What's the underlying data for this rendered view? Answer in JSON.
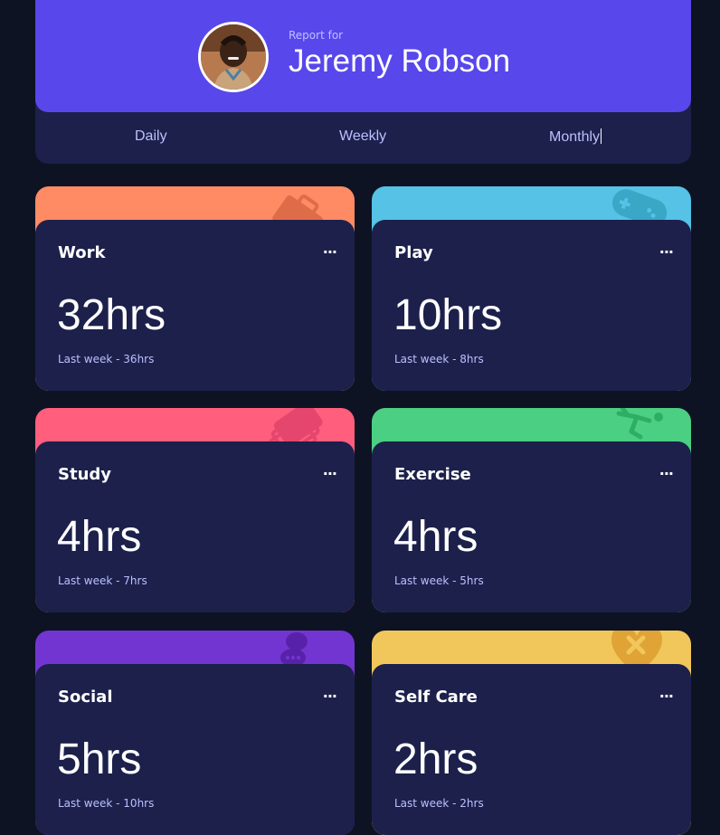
{
  "profile": {
    "report_for": "Report for",
    "name": "Jeremy Robson"
  },
  "tabs": [
    {
      "label": "Daily"
    },
    {
      "label": "Weekly"
    },
    {
      "label": "Monthly",
      "active": true
    }
  ],
  "cards": [
    {
      "title": "Work",
      "hours": "32hrs",
      "previous": "Last week - 36hrs",
      "menu": "...",
      "color": "#ff8b64",
      "icon": "briefcase-icon"
    },
    {
      "title": "Play",
      "hours": "10hrs",
      "previous": "Last week - 8hrs",
      "menu": "...",
      "color": "#55c2e6",
      "icon": "gamepad-icon"
    },
    {
      "title": "Study",
      "hours": "4hrs",
      "previous": "Last week - 7hrs",
      "menu": "...",
      "color": "#ff5e7d",
      "icon": "books-icon"
    },
    {
      "title": "Exercise",
      "hours": "4hrs",
      "previous": "Last week - 5hrs",
      "menu": "...",
      "color": "#4bcf82",
      "icon": "runner-icon"
    },
    {
      "title": "Social",
      "hours": "5hrs",
      "previous": "Last week - 10hrs",
      "menu": "...",
      "color": "#7335d2",
      "icon": "speech-bubbles-icon"
    },
    {
      "title": "Self Care",
      "hours": "2hrs",
      "previous": "Last week - 2hrs",
      "menu": "...",
      "color": "#f1c75b",
      "icon": "heart-icon"
    }
  ]
}
